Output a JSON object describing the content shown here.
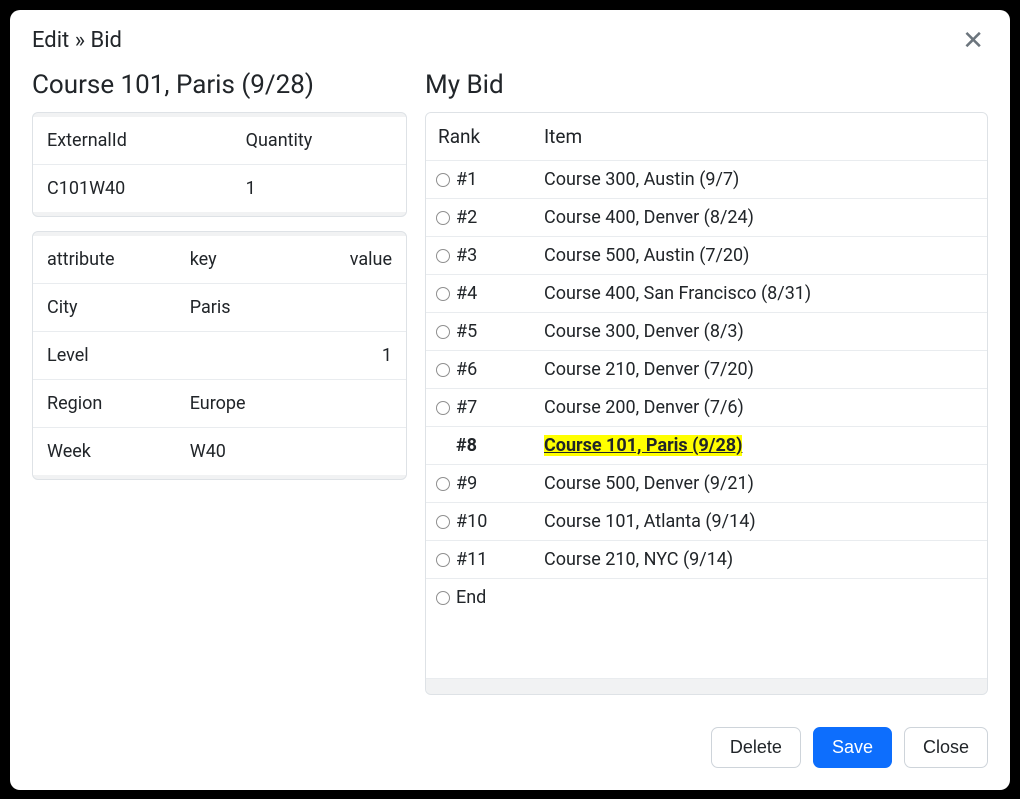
{
  "header": {
    "title": "Edit » Bid"
  },
  "left": {
    "heading": "Course 101, Paris (9/28)",
    "details": {
      "header_externalid": "ExternalId",
      "header_quantity": "Quantity",
      "externalid": "C101W40",
      "quantity": "1"
    },
    "attrs": {
      "header_attribute": "attribute",
      "header_key": "key",
      "header_value": "value",
      "rows": [
        {
          "attr": "City",
          "key": "Paris",
          "value": ""
        },
        {
          "attr": "Level",
          "key": "",
          "value": "1"
        },
        {
          "attr": "Region",
          "key": "Europe",
          "value": ""
        },
        {
          "attr": "Week",
          "key": "W40",
          "value": ""
        }
      ]
    }
  },
  "right": {
    "heading": "My Bid",
    "header_rank": "Rank",
    "header_item": "Item",
    "end_label": "End",
    "rows": [
      {
        "rank": "#1",
        "item": "Course 300, Austin (9/7)",
        "selected": false
      },
      {
        "rank": "#2",
        "item": "Course 400, Denver (8/24)",
        "selected": false
      },
      {
        "rank": "#3",
        "item": "Course 500, Austin (7/20)",
        "selected": false
      },
      {
        "rank": "#4",
        "item": "Course 400, San Francisco (8/31)",
        "selected": false
      },
      {
        "rank": "#5",
        "item": "Course 300, Denver (8/3)",
        "selected": false
      },
      {
        "rank": "#6",
        "item": "Course 210, Denver (7/20)",
        "selected": false
      },
      {
        "rank": "#7",
        "item": "Course 200, Denver (7/6)",
        "selected": false
      },
      {
        "rank": "#8",
        "item": "Course 101, Paris (9/28)",
        "selected": true
      },
      {
        "rank": "#9",
        "item": "Course 500, Denver (9/21)",
        "selected": false
      },
      {
        "rank": "#10",
        "item": "Course 101, Atlanta (9/14)",
        "selected": false
      },
      {
        "rank": "#11",
        "item": "Course 210, NYC (9/14)",
        "selected": false
      }
    ]
  },
  "footer": {
    "delete": "Delete",
    "save": "Save",
    "close": "Close"
  }
}
